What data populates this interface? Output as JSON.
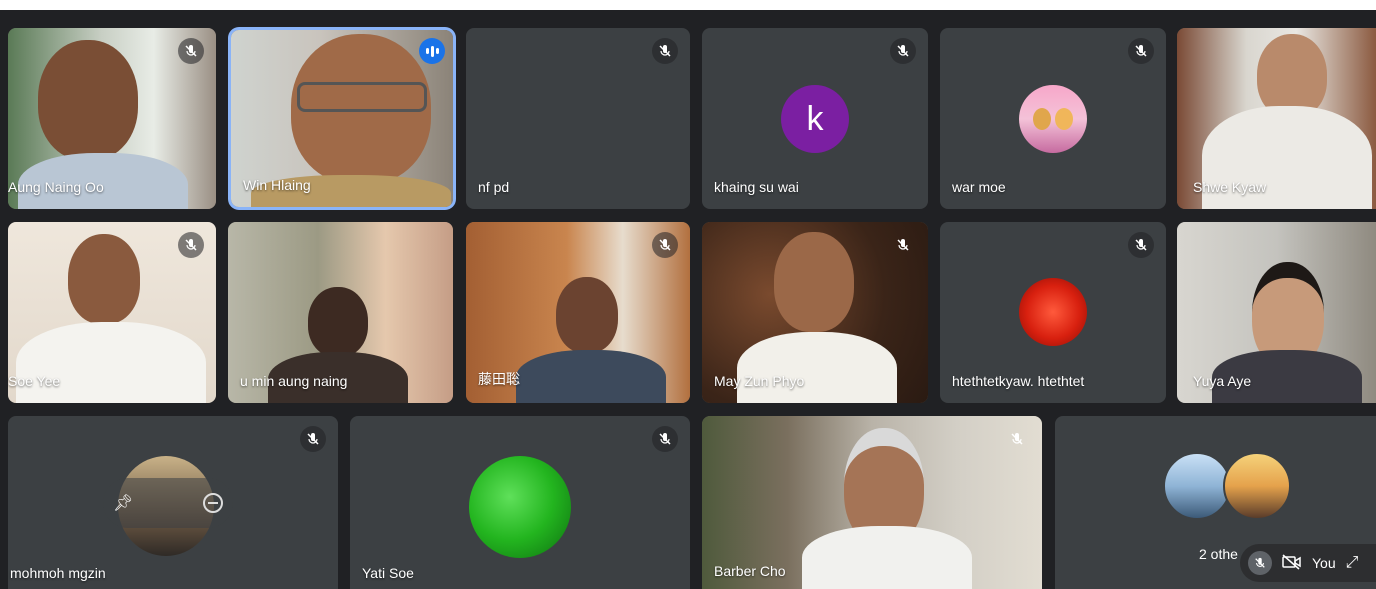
{
  "participants": [
    {
      "name": "Aung Naing Oo"
    },
    {
      "name": "Win Hlaing"
    },
    {
      "name": "nf pd"
    },
    {
      "name": "khaing su wai",
      "initial": "k"
    },
    {
      "name": "war moe"
    },
    {
      "name": "Shwe Kyaw"
    },
    {
      "name": "Soe Yee"
    },
    {
      "name": "u min aung naing"
    },
    {
      "name": "藤田聡"
    },
    {
      "name": "May Zun Phyo"
    },
    {
      "name": "htethtetkyaw. htethtet"
    },
    {
      "name": "Yuya Aye"
    },
    {
      "name": "mohmoh mgzin"
    },
    {
      "name": "Yati Soe"
    },
    {
      "name": "Barber Cho"
    }
  ],
  "others_tile": {
    "label": "2 othe"
  },
  "self_view": {
    "label": "You"
  },
  "colors": {
    "speaking": "#1a73e8",
    "tile_bg": "#3c4043",
    "page_bg": "#202124"
  }
}
